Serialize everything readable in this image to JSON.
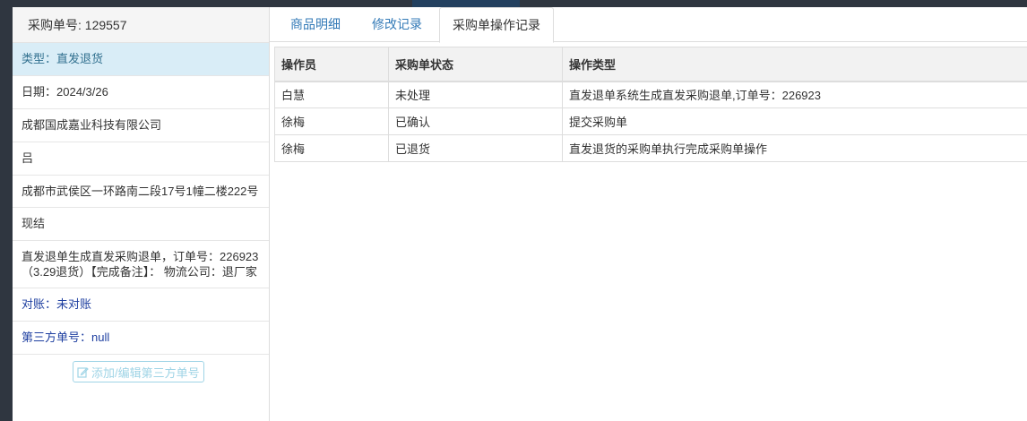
{
  "panel": {
    "header": "采购单号: 129557",
    "items": [
      {
        "text": "类型：直发退货"
      },
      {
        "text": "日期：2024/3/26"
      },
      {
        "text": "成都国成嘉业科技有限公司"
      },
      {
        "text": "吕"
      },
      {
        "text": "成都市武侯区一环路南二段17号1幢二楼222号"
      },
      {
        "text": "现结"
      },
      {
        "text": "直发退单生成直发采购退单，订单号：226923（3.29退货）【完成备注】： 物流公司：退厂家"
      },
      {
        "text": "对账：未对账"
      },
      {
        "text": "第三方单号：null"
      }
    ],
    "edit_button": "添加/编辑第三方单号"
  },
  "tabs": [
    {
      "label": "商品明细"
    },
    {
      "label": "修改记录"
    },
    {
      "label": "采购单操作记录"
    }
  ],
  "table": {
    "headers": [
      "操作员",
      "采购单状态",
      "操作类型"
    ],
    "rows": [
      [
        "白慧",
        "未处理",
        "直发退单系统生成直发采购退单,订单号：226923"
      ],
      [
        "徐梅",
        "已确认",
        "提交采购单"
      ],
      [
        "徐梅",
        "已退货",
        "直发退货的采购单执行完成采购单操作"
      ]
    ]
  },
  "colors": {
    "active_item_bg": "#d9edf7",
    "link_blue": "#337ab7",
    "dark_navy_text": "#1e3fa0",
    "disabled_button": "#9fd4e6"
  },
  "icons": {
    "edit": "edit-square-icon"
  }
}
